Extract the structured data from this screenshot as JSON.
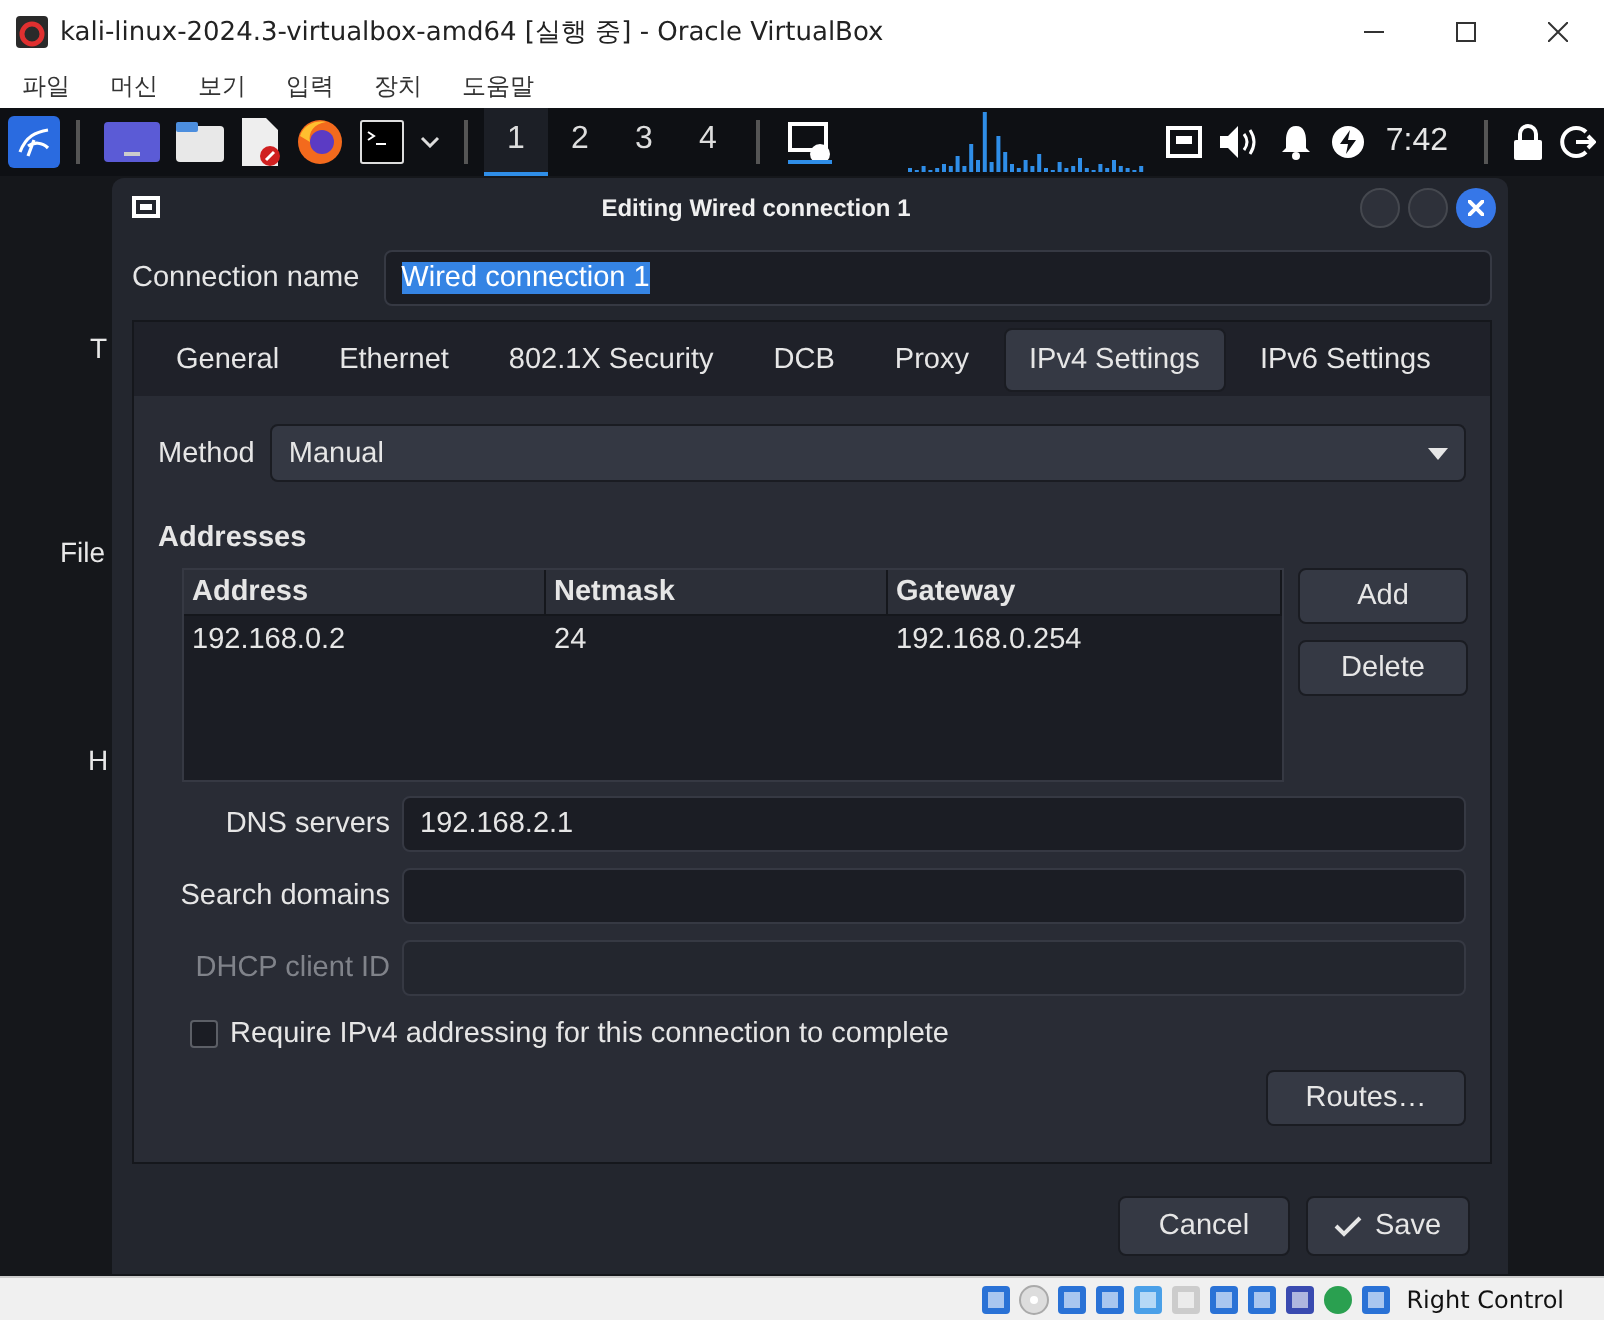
{
  "window": {
    "title": "kali-linux-2024.3-virtualbox-amd64 [실행 중] - Oracle VirtualBox"
  },
  "menu": [
    "파일",
    "머신",
    "보기",
    "입력",
    "장치",
    "도움말"
  ],
  "panel": {
    "workspaces": [
      {
        "label": "1",
        "selected": true
      },
      {
        "label": "2",
        "selected": false
      },
      {
        "label": "3",
        "selected": false
      },
      {
        "label": "4",
        "selected": false
      }
    ],
    "clock": "7:42"
  },
  "desktop": {
    "labels": [
      "T",
      "File",
      "H"
    ]
  },
  "dialog": {
    "title": "Editing Wired connection 1",
    "connection_name": {
      "label": "Connection name",
      "value": "Wired connection 1",
      "text_selected": true
    },
    "tabs": [
      {
        "label": "General",
        "selected": false
      },
      {
        "label": "Ethernet",
        "selected": false
      },
      {
        "label": "802.1X Security",
        "selected": false
      },
      {
        "label": "DCB",
        "selected": false
      },
      {
        "label": "Proxy",
        "selected": false
      },
      {
        "label": "IPv4 Settings",
        "selected": true
      },
      {
        "label": "IPv6 Settings",
        "selected": false
      }
    ],
    "method": {
      "label": "Method",
      "value": "Manual"
    },
    "addresses": {
      "label": "Addresses",
      "columns": [
        "Address",
        "Netmask",
        "Gateway"
      ],
      "rows": [
        [
          "192.168.0.2",
          "24",
          "192.168.0.254"
        ]
      ],
      "buttons": [
        "Add",
        "Delete"
      ]
    },
    "fields": [
      {
        "label": "DNS servers",
        "value": "192.168.2.1",
        "disabled": false
      },
      {
        "label": "Search domains",
        "disabled": false
      },
      {
        "label": "DHCP client ID",
        "disabled": true
      }
    ],
    "require": {
      "label": "Require IPv4 addressing for this connection to complete",
      "checked": false
    },
    "routes_button": "Routes…",
    "buttons": [
      {
        "label": "Cancel",
        "kind": "plain"
      },
      {
        "label": "Save",
        "kind": "save"
      }
    ]
  },
  "status_bar": {
    "host_key": "Right Control"
  }
}
